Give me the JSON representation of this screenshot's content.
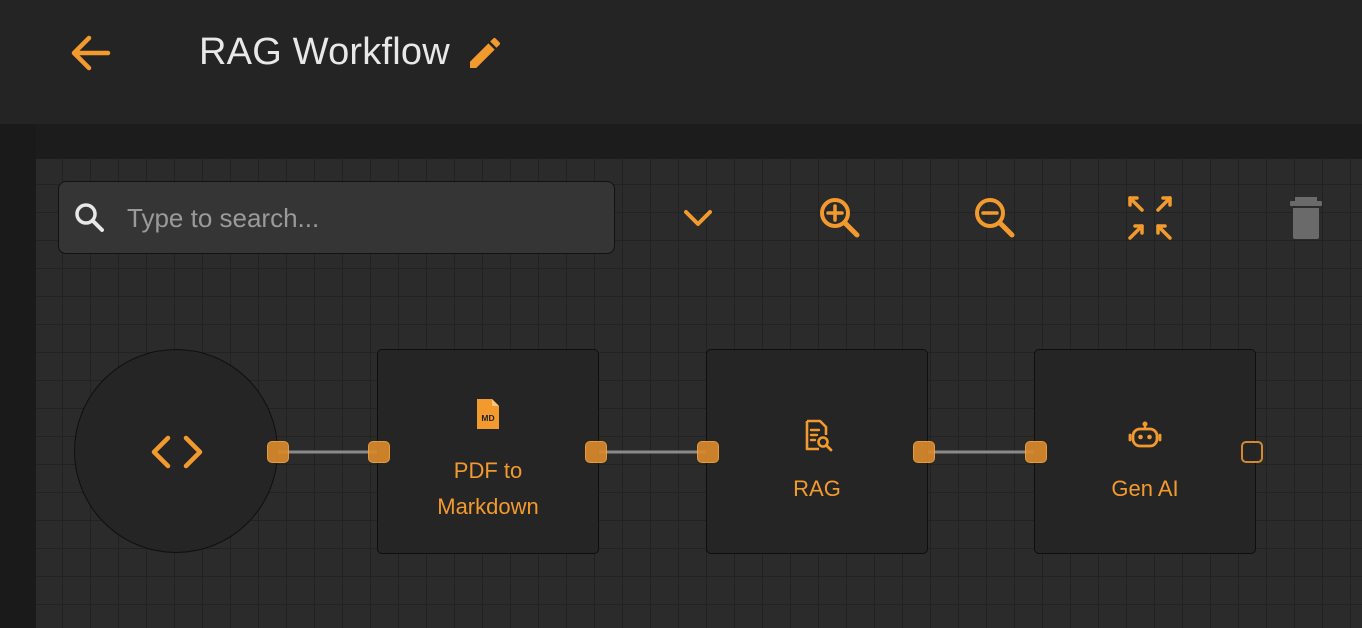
{
  "header": {
    "title": "RAG Workflow",
    "back_icon": "arrow-left-icon",
    "edit_icon": "pencil-icon"
  },
  "toolbar": {
    "search_placeholder": "Type to search...",
    "search_value": "",
    "icons": [
      "search-icon",
      "chevron-down-icon",
      "zoom-in-icon",
      "zoom-out-icon",
      "fit-view-icon",
      "trash-icon"
    ]
  },
  "nodes": {
    "start": {
      "icon": "code-brackets-icon"
    },
    "pdf_to_markdown": {
      "label_line1": "PDF to",
      "label_line2": "Markdown",
      "icon": "markdown-file-icon"
    },
    "rag": {
      "label": "RAG",
      "icon": "document-search-icon"
    },
    "gen_ai": {
      "label": "Gen AI",
      "icon": "robot-icon"
    }
  },
  "colors": {
    "accent": "#f39a2e",
    "background": "#1e1e1e",
    "header": "#242424",
    "canvas": "#2b2b2b",
    "edge": "#8a8a8a",
    "disabled_icon": "#6a6a6a"
  }
}
